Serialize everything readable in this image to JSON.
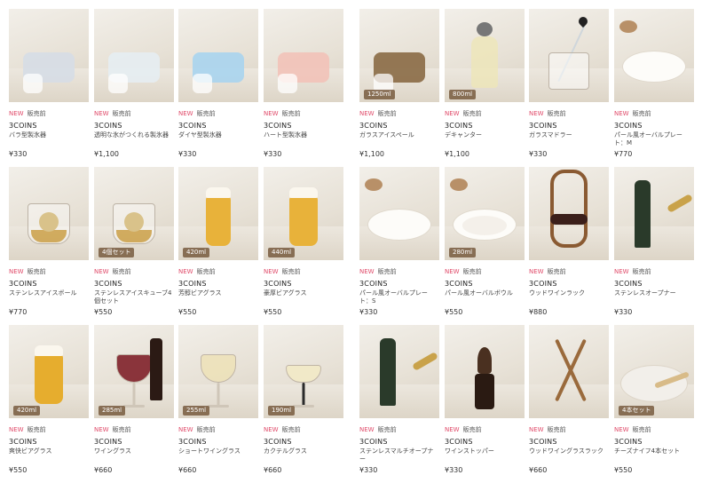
{
  "left": [
    [
      {
        "brand": "3COINS",
        "name": "バラ型製氷器",
        "price": "¥330",
        "new": "NEW",
        "status": "販売前",
        "caption": "",
        "visual": "ice-rose",
        "accent": "#d6dde6"
      },
      {
        "brand": "3COINS",
        "name": "透明な氷がつくれる製氷器",
        "price": "¥1,100",
        "new": "NEW",
        "status": "販売前",
        "caption": "",
        "visual": "ice-clear",
        "accent": "#e6edf2"
      },
      {
        "brand": "3COINS",
        "name": "ダイヤ型製氷器",
        "price": "¥330",
        "new": "NEW",
        "status": "販売前",
        "caption": "",
        "visual": "ice-diamond",
        "accent": "#a9d4ee"
      },
      {
        "brand": "3COINS",
        "name": "ハート型製氷器",
        "price": "¥330",
        "new": "NEW",
        "status": "販売前",
        "caption": "",
        "visual": "ice-heart",
        "accent": "#f2c2b8"
      }
    ],
    [
      {
        "brand": "3COINS",
        "name": "ステンレスアイスボール",
        "price": "¥770",
        "new": "NEW",
        "status": "販売前",
        "caption": "",
        "visual": "whisky-ball",
        "accent": "#c89a3c"
      },
      {
        "brand": "3COINS",
        "name": "ステンレスアイスキューブ4個セット",
        "price": "¥550",
        "new": "NEW",
        "status": "販売前",
        "caption": "4個セット",
        "visual": "whisky-cube",
        "accent": "#c89a3c"
      },
      {
        "brand": "3COINS",
        "name": "芳醇ビアグラス",
        "price": "¥550",
        "new": "NEW",
        "status": "販売前",
        "caption": "420ml",
        "visual": "beer-tulip",
        "accent": "#e8b23a"
      },
      {
        "brand": "3COINS",
        "name": "豪厚ビアグラス",
        "price": "¥550",
        "new": "NEW",
        "status": "販売前",
        "caption": "440ml",
        "visual": "beer-pint",
        "accent": "#e8b23a"
      }
    ],
    [
      {
        "brand": "3COINS",
        "name": "爽快ビアグラス",
        "price": "¥550",
        "new": "NEW",
        "status": "販売前",
        "caption": "420ml",
        "visual": "beer-straight",
        "accent": "#e6ad2e"
      },
      {
        "brand": "3COINS",
        "name": "ワイングラス",
        "price": "¥660",
        "new": "NEW",
        "status": "販売前",
        "caption": "285ml",
        "visual": "wine-red",
        "accent": "#7a1620"
      },
      {
        "brand": "3COINS",
        "name": "ショートワイングラス",
        "price": "¥660",
        "new": "NEW",
        "status": "販売前",
        "caption": "255ml",
        "visual": "wine-white",
        "accent": "#eee2b8"
      },
      {
        "brand": "3COINS",
        "name": "カクテルグラス",
        "price": "¥660",
        "new": "NEW",
        "status": "販売前",
        "caption": "190ml",
        "visual": "cocktail",
        "accent": "#f3ebc6"
      }
    ]
  ],
  "right": [
    [
      {
        "brand": "3COINS",
        "name": "ガラスアイスペール",
        "price": "¥1,100",
        "new": "NEW",
        "status": "販売前",
        "caption": "1250ml",
        "visual": "ice-pail",
        "accent": "#8a6a45"
      },
      {
        "brand": "3COINS",
        "name": "デキャンター",
        "price": "¥1,100",
        "new": "NEW",
        "status": "販売前",
        "caption": "800ml",
        "visual": "decanter",
        "accent": "#eee6b8"
      },
      {
        "brand": "3COINS",
        "name": "ガラスマドラー",
        "price": "¥330",
        "new": "NEW",
        "status": "販売前",
        "caption": "",
        "visual": "muddler",
        "accent": "#222222"
      },
      {
        "brand": "3COINS",
        "name": "パール風オーバルプレート：M",
        "price": "¥770",
        "new": "NEW",
        "status": "販売前",
        "caption": "",
        "visual": "plate-m",
        "accent": "#ffffff"
      }
    ],
    [
      {
        "brand": "3COINS",
        "name": "パール風オーバルプレート：S",
        "price": "¥330",
        "new": "NEW",
        "status": "販売前",
        "caption": "",
        "visual": "plate-s",
        "accent": "#ffffff"
      },
      {
        "brand": "3COINS",
        "name": "パール風オーバルボウル",
        "price": "¥550",
        "new": "NEW",
        "status": "販売前",
        "caption": "280ml",
        "visual": "bowl",
        "accent": "#ffffff"
      },
      {
        "brand": "3COINS",
        "name": "ウッドワインラック",
        "price": "¥880",
        "new": "NEW",
        "status": "販売前",
        "caption": "",
        "visual": "wine-rack",
        "accent": "#8a5a32"
      },
      {
        "brand": "3COINS",
        "name": "ステンレスオープナー",
        "price": "¥330",
        "new": "NEW",
        "status": "販売前",
        "caption": "",
        "visual": "opener",
        "accent": "#c9a24a"
      }
    ],
    [
      {
        "brand": "3COINS",
        "name": "ステンレスマルチオープナー",
        "price": "¥330",
        "new": "NEW",
        "status": "販売前",
        "caption": "",
        "visual": "multi-opener",
        "accent": "#c9a24a"
      },
      {
        "brand": "3COINS",
        "name": "ワインストッパー",
        "price": "¥330",
        "new": "NEW",
        "status": "販売前",
        "caption": "",
        "visual": "stopper",
        "accent": "#4a3020"
      },
      {
        "brand": "3COINS",
        "name": "ウッドワイングラスラック",
        "price": "¥660",
        "new": "NEW",
        "status": "販売前",
        "caption": "",
        "visual": "glass-rack",
        "accent": "#9a6a3c"
      },
      {
        "brand": "3COINS",
        "name": "チーズナイフ4本セット",
        "price": "¥550",
        "new": "NEW",
        "status": "販売前",
        "caption": "4本セット",
        "visual": "cheese-knife",
        "accent": "#d8bb88"
      }
    ]
  ]
}
